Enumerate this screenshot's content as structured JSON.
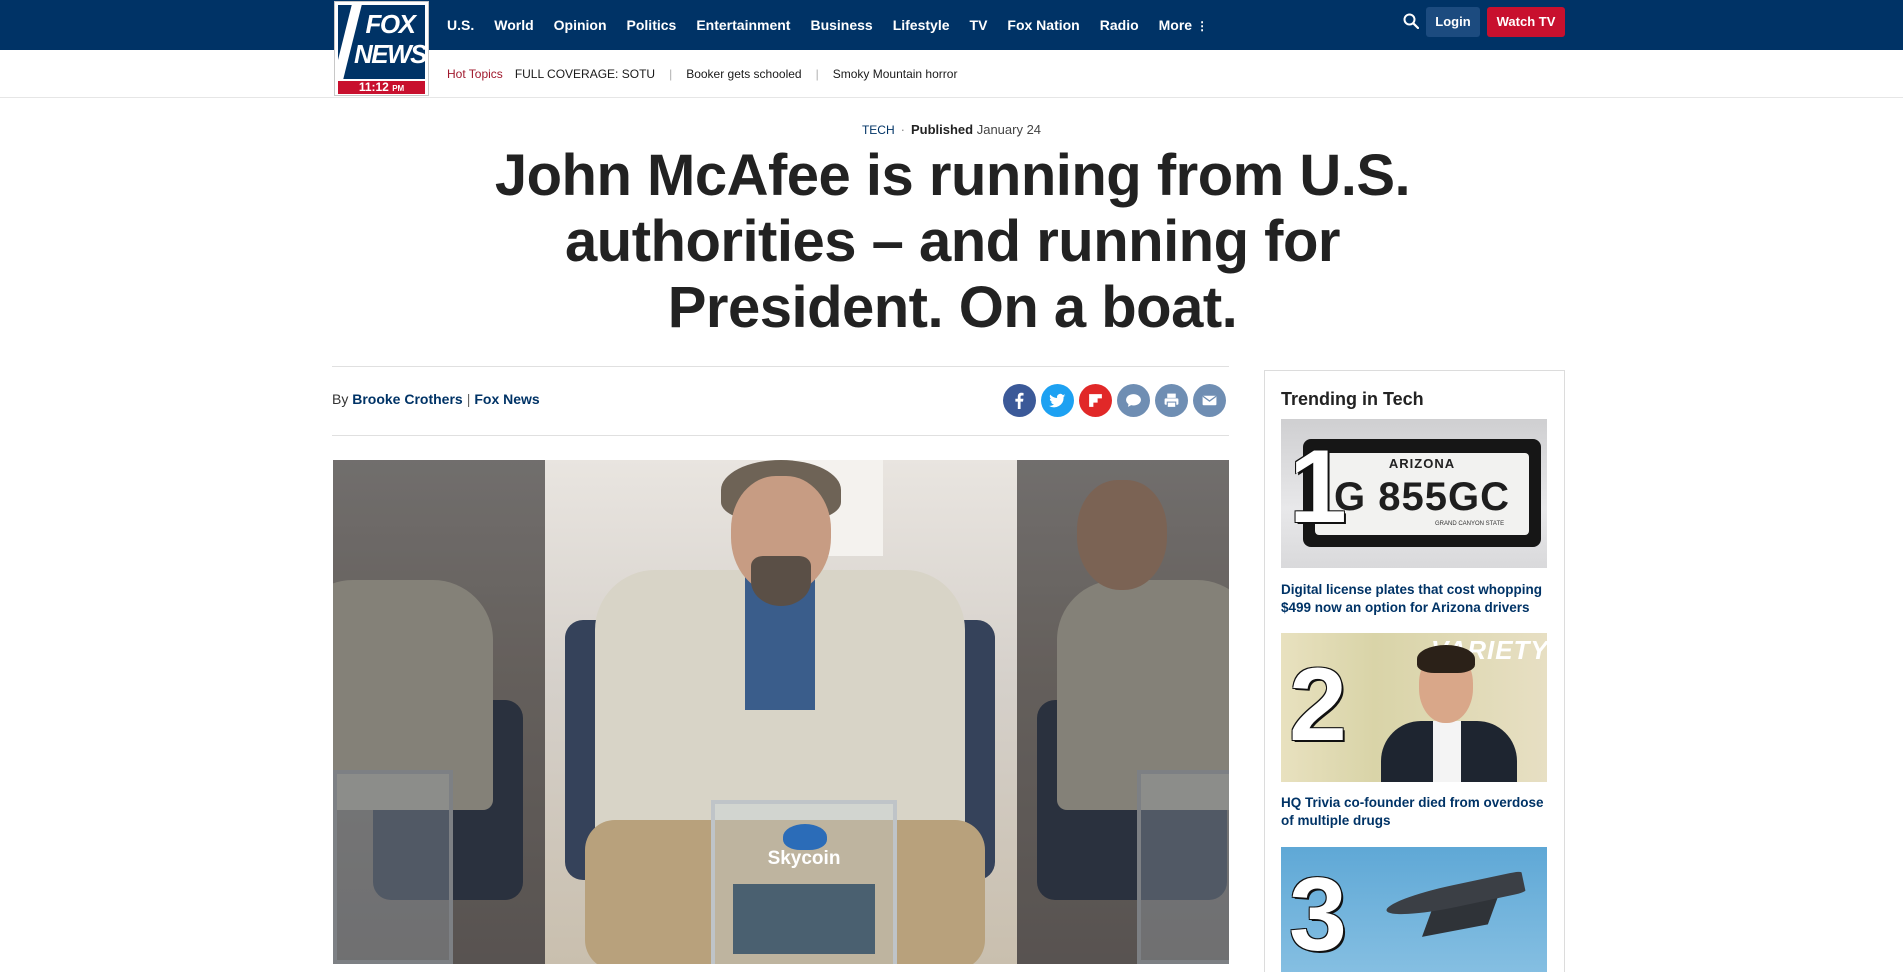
{
  "header": {
    "logo_text": "FOX NEWS",
    "logo_time": "11:12",
    "logo_ampm": "PM",
    "nav": [
      "U.S.",
      "World",
      "Opinion",
      "Politics",
      "Entertainment",
      "Business",
      "Lifestyle",
      "TV",
      "Fox Nation",
      "Radio",
      "More"
    ],
    "login_label": "Login",
    "watch_label": "Watch TV"
  },
  "subnav": {
    "hot_label": "Hot Topics",
    "links": [
      "FULL COVERAGE: SOTU",
      "Booker gets schooled",
      "Smoky Mountain horror"
    ]
  },
  "article": {
    "category": "TECH",
    "published_label": "Published",
    "published_date": "January 24",
    "headline": "John McAfee is running from U.S. authorities – and running for President. On a boat.",
    "by_label": "By",
    "author": "Brooke Crothers",
    "outlet": "Fox News",
    "hero_box_text": "Skycoin"
  },
  "share": [
    "facebook-icon",
    "twitter-icon",
    "flipboard-icon",
    "comment-icon",
    "print-icon",
    "email-icon"
  ],
  "colors": {
    "brand_navy": "#003366",
    "brand_red": "#c8102e",
    "facebook": "#3b5998",
    "twitter": "#1da1f2",
    "flipboard": "#e12828",
    "gray_icon": "#6f8eb3"
  },
  "sidebar": {
    "title": "Trending in Tech",
    "items": [
      {
        "rank": "1",
        "caption": "Digital license plates that cost whopping $499 now an option for Arizona drivers",
        "plate_state": "ARIZONA",
        "plate_number": "G 855GC",
        "plate_sub": "GRAND CANYON STATE"
      },
      {
        "rank": "2",
        "caption": "HQ Trivia co-founder died from overdose of multiple drugs",
        "backdrop_text": "VARIETY"
      },
      {
        "rank": "3",
        "caption": ""
      }
    ]
  }
}
